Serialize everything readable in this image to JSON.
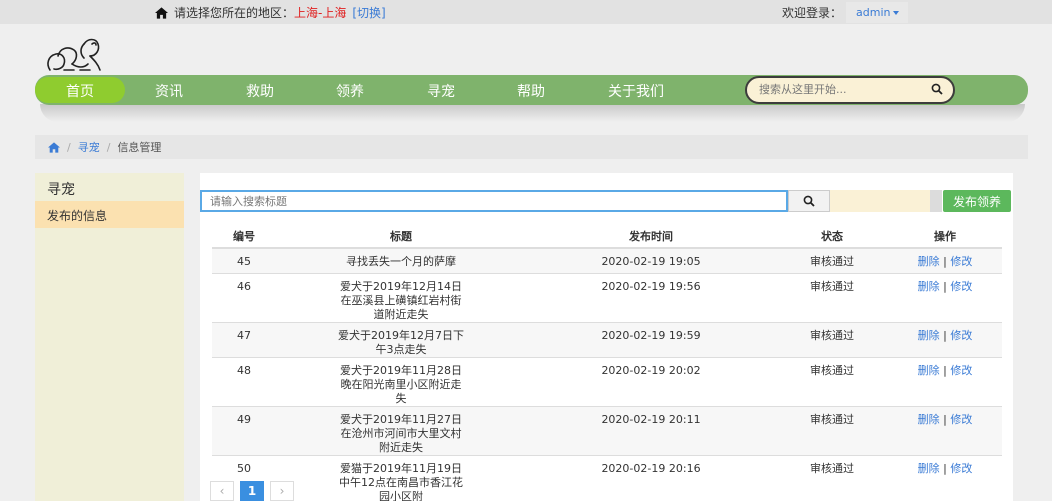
{
  "topbar": {
    "region_prompt": "请选择您所在的地区：",
    "region_city": "上海-上海",
    "region_switch": "[切换]",
    "welcome": "欢迎登录：",
    "user": "admin"
  },
  "nav": {
    "items": [
      "首页",
      "资讯",
      "救助",
      "领养",
      "寻宠",
      "帮助",
      "关于我们"
    ],
    "active_index": 0,
    "search_placeholder": "搜索从这里开始..."
  },
  "breadcrumb": {
    "items": [
      "寻宠",
      "信息管理"
    ]
  },
  "sidebar": {
    "title": "寻宠",
    "items": [
      "发布的信息"
    ]
  },
  "main": {
    "search_placeholder": "请输入搜索标题",
    "publish_label": "发布领养",
    "columns": [
      "编号",
      "标题",
      "发布时间",
      "状态",
      "操作"
    ],
    "rows": [
      {
        "id": "45",
        "title": "寻找丢失一个月的萨摩",
        "time": "2020-02-19 19:05",
        "status": "审核通过"
      },
      {
        "id": "46",
        "title": "爱犬于2019年12月14日在巫溪县上磺镇红岩村街道附近走失",
        "time": "2020-02-19 19:56",
        "status": "审核通过"
      },
      {
        "id": "47",
        "title": "爱犬于2019年12月7日下午3点走失",
        "time": "2020-02-19 19:59",
        "status": "审核通过"
      },
      {
        "id": "48",
        "title": "爱犬于2019年11月28日晚在阳光南里小区附近走失",
        "time": "2020-02-19 20:02",
        "status": "审核通过"
      },
      {
        "id": "49",
        "title": "爱犬于2019年11月27日在沧州市河间市大里文村附近走失",
        "time": "2020-02-19 20:11",
        "status": "审核通过"
      },
      {
        "id": "50",
        "title": "爱猫于2019年11月19日中午12点在南昌市香江花园小区附",
        "time": "2020-02-19 20:16",
        "status": "审核通过"
      }
    ],
    "op_delete": "删除",
    "op_sep": "|",
    "op_edit": "修改"
  },
  "pager": {
    "prev": "‹",
    "current": "1",
    "next": "›"
  },
  "colors": {
    "nav_bg": "#7fb36c",
    "nav_active": "#8fcc2f",
    "publish": "#5cb85c",
    "link": "#3a7bd5",
    "sidebar_active": "#fbe1b0"
  }
}
